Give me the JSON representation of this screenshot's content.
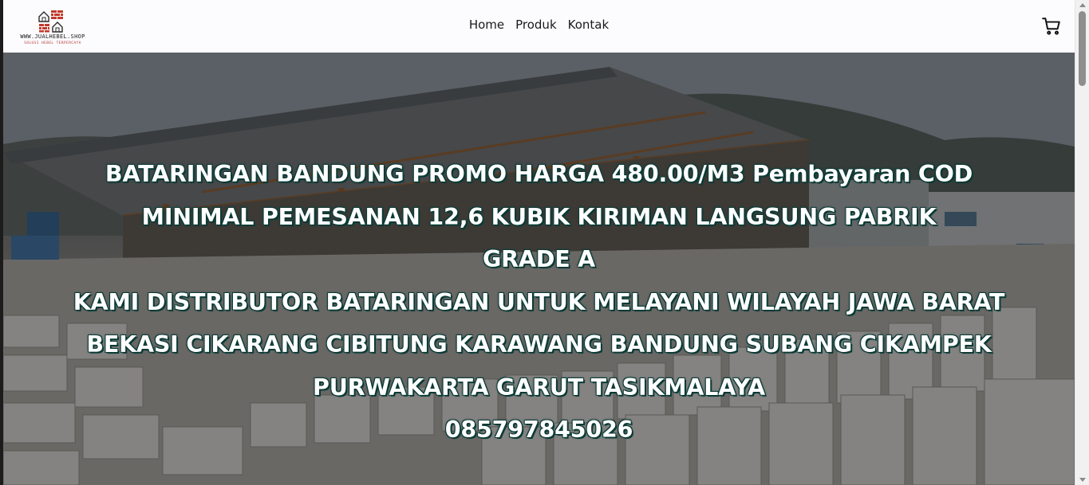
{
  "logo": {
    "url_text": "WWW.JUALHEBEL.SHOP",
    "tagline": "SOLUSI HEBEL TERPERCAYA",
    "icon": "brick-house-logo-icon",
    "brand_color": "#c0392b"
  },
  "nav": {
    "items": [
      {
        "label": "Home"
      },
      {
        "label": "Produk"
      },
      {
        "label": "Kontak"
      }
    ]
  },
  "cart": {
    "icon": "shopping-cart-icon"
  },
  "hero": {
    "lines": [
      "BATARINGAN BANDUNG PROMO HARGA 480.00/M3 Pembayaran COD",
      "MINIMAL PEMESANAN 12,6 KUBIK KIRIMAN LANGSUNG PABRIK",
      "GRADE A",
      "KAMI DISTRIBUTOR BATARINGAN UNTUK MELAYANI WILAYAH JAWA BARAT",
      "BEKASI CIKARANG CIBITUNG KARAWANG BANDUNG SUBANG CIKAMPEK",
      "PURWAKARTA GARUT TASIKMALAYA",
      "085797845026"
    ],
    "text_color": "#ffffff",
    "outline_color": "#0b3b36"
  }
}
